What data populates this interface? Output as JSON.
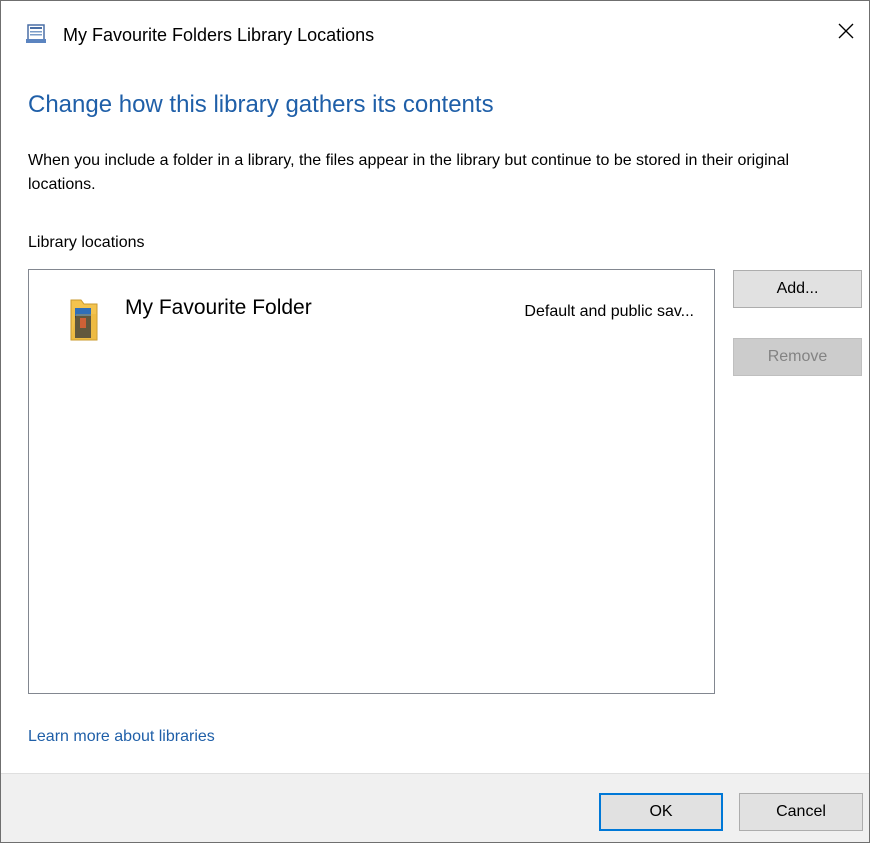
{
  "window": {
    "title": "My Favourite Folders Library Locations",
    "close_glyph": "✕"
  },
  "heading": "Change how this library gathers its contents",
  "description": "When you include a folder in a library, the files appear in the library but continue to be stored in their original locations.",
  "locations_label": "Library locations",
  "locations": [
    {
      "name": "My Favourite Folder",
      "status": "Default and public sav...",
      "icon": "folder-icon"
    }
  ],
  "buttons": {
    "add": "Add...",
    "remove": "Remove",
    "ok": "OK",
    "cancel": "Cancel"
  },
  "learn_more": "Learn more about libraries",
  "colors": {
    "heading": "#1f5fa8",
    "link": "#1f5fa8",
    "focus_border": "#0078d7",
    "footer_bg": "#f0f0f0"
  }
}
